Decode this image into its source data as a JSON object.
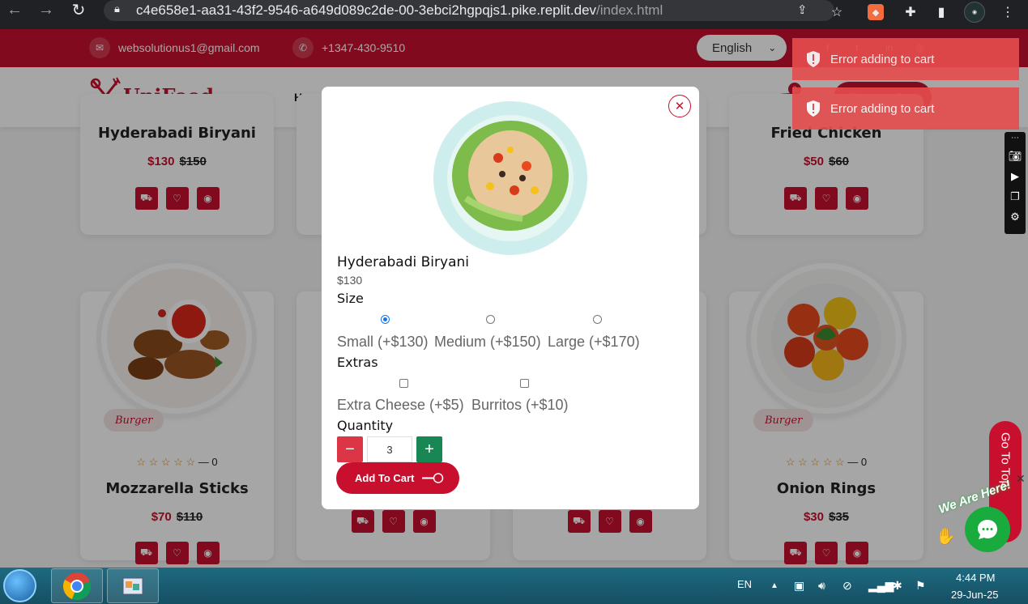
{
  "browser": {
    "url_host": "c4e658e1-aa31-43f2-9546-a649d089c2de-00-3ebci2hgpqjs1.pike.replit.dev",
    "url_path": "/index.html"
  },
  "topbar": {
    "email": "websolutionus1@gmail.com",
    "phone": "+1347-430-9510",
    "language": "English"
  },
  "header": {
    "logo": "UniFood",
    "nav_home": "Home",
    "cart_count": "0",
    "reservation": "Reservation"
  },
  "cards": [
    {
      "title": "Hyderabadi Biryani",
      "price": "$130",
      "old_price": "$150"
    },
    {
      "title": "Fried Chicken",
      "price": "$50",
      "old_price": "$60"
    },
    {
      "title": "Mozzarella Sticks",
      "price": "$70",
      "old_price": "$110",
      "badge": "Burger",
      "rating_count": "0"
    },
    {
      "title": "Onion Rings",
      "price": "$30",
      "old_price": "$35",
      "badge": "Burger",
      "rating_count": "0"
    }
  ],
  "modal": {
    "title": "Hyderabadi Biryani",
    "price": "$130",
    "size_heading": "Size",
    "sizes": [
      {
        "label": "Small (+$130)",
        "selected": true
      },
      {
        "label": "Medium (+$150)",
        "selected": false
      },
      {
        "label": "Large (+$170)",
        "selected": false
      }
    ],
    "extras_heading": "Extras",
    "extras": [
      {
        "label": "Extra Cheese (+$5)",
        "checked": false
      },
      {
        "label": "Burritos (+$10)",
        "checked": false
      }
    ],
    "quantity_heading": "Quantity",
    "quantity": "3",
    "minus": "−",
    "plus": "+",
    "add_to_cart": "Add To Cart"
  },
  "toasts": [
    "Error adding to cart",
    "Error adding to cart"
  ],
  "widgets": {
    "go_to_top": "Go To Top",
    "we_are_here": "We Are Here!"
  },
  "taskbar": {
    "lang": "EN",
    "time": "4:44 PM",
    "date": "29-Jun-25"
  },
  "colors": {
    "brand": "#c8102e",
    "toast": "#e64d4d",
    "chat": "#1aab3f"
  }
}
